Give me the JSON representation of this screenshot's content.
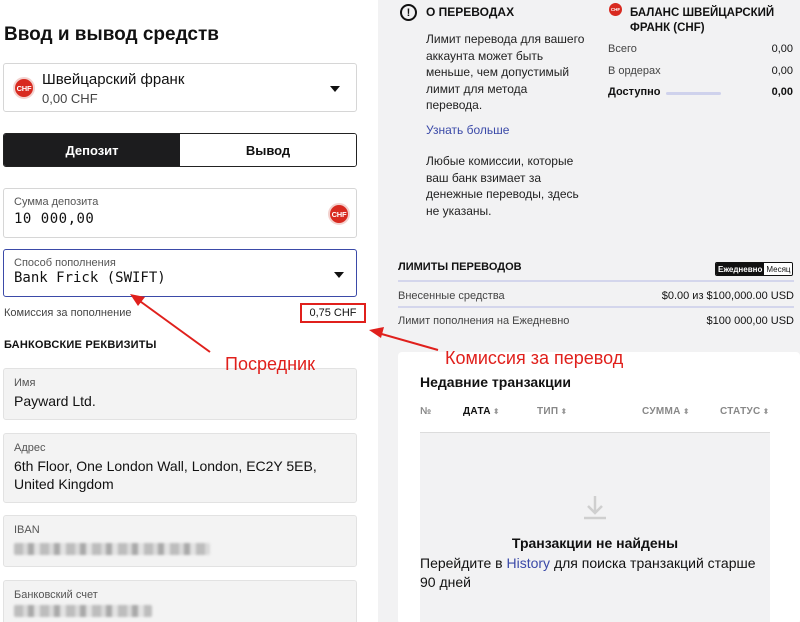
{
  "page": {
    "title": "Ввод и вывод средств"
  },
  "currency": {
    "name": "Швейцарский франк",
    "balance": "0,00 CHF",
    "badge": "CHF"
  },
  "tabs": {
    "deposit": "Депозит",
    "withdraw": "Вывод"
  },
  "amount": {
    "label": "Сумма депозита",
    "value": "10 000,00"
  },
  "method": {
    "label": "Способ пополнения",
    "value": "Bank Frick (SWIFT)"
  },
  "fee": {
    "label": "Комиссия за пополнение",
    "value": "0,75 CHF"
  },
  "bank": {
    "title": "БАНКОВСКИЕ РЕКВИЗИТЫ",
    "name_label": "Имя",
    "name_value": "Payward Ltd.",
    "address_label": "Адрес",
    "address_value": "6th Floor, One London Wall, London, EC2Y 5EB, United Kingdom",
    "iban_label": "IBAN",
    "account_label": "Банковский счет"
  },
  "info": {
    "title": "О ПЕРЕВОДАХ",
    "text": "Лимит перевода для вашего аккаунта может быть меньше, чем допустимый лимит для метода перевода.",
    "learn_more": "Узнать больше",
    "text2": "Любые комиссии, которые ваш банк взимает за денежные переводы, здесь не указаны."
  },
  "balance": {
    "badge": "CHF",
    "title": "БАЛАНС ШВЕЙЦАРСКИЙ ФРАНК (CHF)",
    "total_label": "Всего",
    "total_value": "0,00",
    "orders_label": "В ордерах",
    "orders_value": "0,00",
    "available_label": "Доступно",
    "available_value": "0,00"
  },
  "limits": {
    "title": "ЛИМИТЫ ПЕРЕВОДОВ",
    "period_daily": "Ежедневно",
    "period_monthly": "Месяц",
    "deposited_label": "Внесенные средства",
    "deposited_value": "$0.00 из $100,000.00 USD",
    "limit_label": "Лимит пополнения на Ежедневно",
    "limit_value": "$100 000,00 USD"
  },
  "transactions": {
    "title": "Недавние транзакции",
    "columns": [
      "№",
      "ДАТА",
      "ТИП",
      "СУММА",
      "СТАТУС"
    ],
    "empty_title": "Транзакции не найдены",
    "empty_prefix": "Перейдите в ",
    "empty_link": "History",
    "empty_suffix": " для поиска транзакций старше 90 дней"
  },
  "annotations": {
    "intermediary": "Посредник",
    "transfer_fee": "Комиссия за перевод"
  },
  "colors": {
    "accent": "#3b4aa8",
    "annotation": "#e0201c",
    "chf_badge": "#d82a20"
  }
}
